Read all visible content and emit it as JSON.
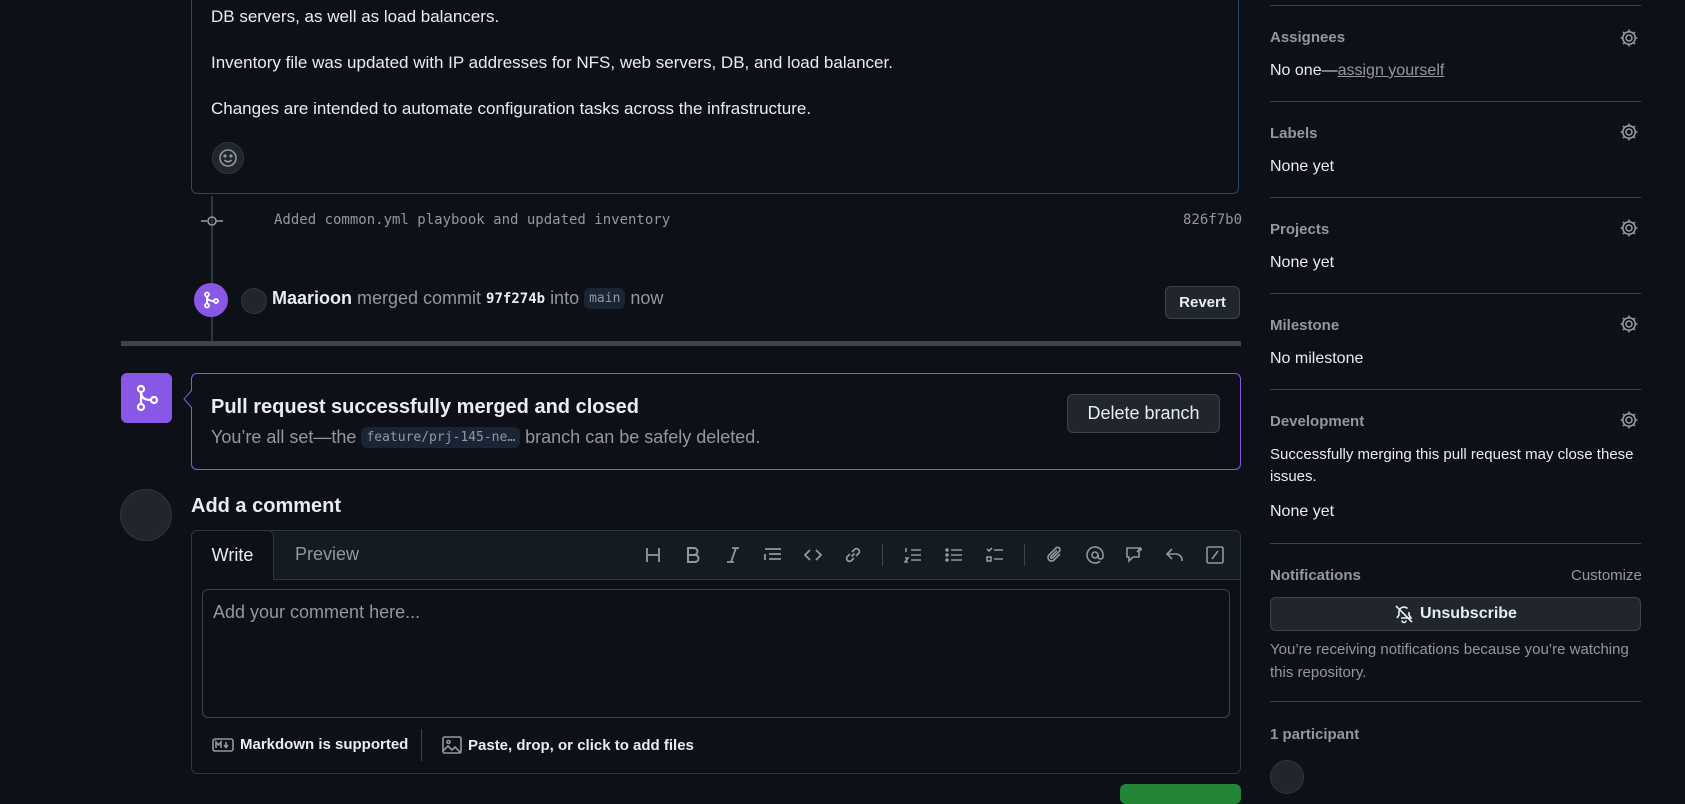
{
  "description": {
    "line1": "DB servers, as well as load balancers.",
    "line2": "Inventory file was updated with IP addresses for NFS, web servers, DB, and load balancer.",
    "line3": "Changes are intended to automate configuration tasks across the infrastructure."
  },
  "commit": {
    "message": "Added common.yml playbook and updated inventory",
    "sha": "826f7b0"
  },
  "merge_event": {
    "user": "Maarioon",
    "action": "merged commit",
    "sha": "97f274b",
    "into_text": "into",
    "branch": "main",
    "time": "now",
    "revert_label": "Revert"
  },
  "merged_box": {
    "title": "Pull request successfully merged and closed",
    "sub_prefix": "You’re all set—the",
    "branch_chip": "feature/prj-145-ne…",
    "sub_suffix": "branch can be safely deleted.",
    "delete_label": "Delete branch"
  },
  "comment": {
    "heading": "Add a comment",
    "tab_write": "Write",
    "tab_preview": "Preview",
    "placeholder": "Add your comment here...",
    "markdown_label": "Markdown is supported",
    "attach_label": "Paste, drop, or click to add files"
  },
  "toolbar_icons": [
    "heading-icon",
    "bold-icon",
    "italic-icon",
    "quote-icon",
    "code-icon",
    "link-icon",
    "ordered-list-icon",
    "unordered-list-icon",
    "task-list-icon",
    "attachment-icon",
    "mention-icon",
    "reference-icon",
    "reply-icon",
    "slash-command-icon"
  ],
  "sidebar": {
    "assignees": {
      "heading": "Assignees",
      "value_prefix": "No one—",
      "value_link": "assign yourself"
    },
    "labels": {
      "heading": "Labels",
      "value": "None yet"
    },
    "projects": {
      "heading": "Projects",
      "value": "None yet"
    },
    "milestone": {
      "heading": "Milestone",
      "value": "No milestone"
    },
    "development": {
      "heading": "Development",
      "note": "Successfully merging this pull request may close these issues.",
      "value": "None yet"
    },
    "notifications": {
      "heading": "Notifications",
      "customize": "Customize",
      "unsubscribe_label": "Unsubscribe",
      "note": "You’re receiving notifications because you’re watching this repository."
    },
    "participants": {
      "heading": "1 participant"
    }
  },
  "colors": {
    "background": "#0d1117",
    "merged_purple": "#8957e5",
    "green": "#238636",
    "border": "#30363d"
  }
}
